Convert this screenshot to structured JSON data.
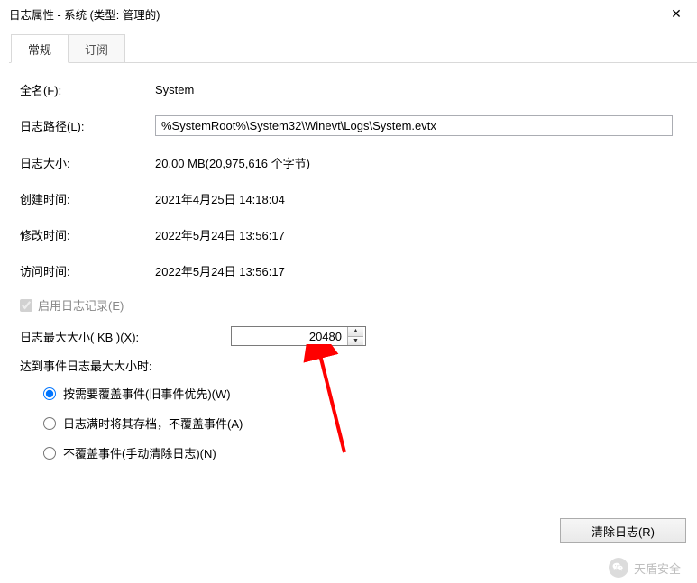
{
  "window": {
    "title": "日志属性 - 系统 (类型: 管理的)",
    "close_glyph": "✕"
  },
  "tabs": {
    "general": "常规",
    "subscribe": "订阅"
  },
  "fields": {
    "fullname_label": "全名(F):",
    "fullname_value": "System",
    "path_label": "日志路径(L):",
    "path_value": "%SystemRoot%\\System32\\Winevt\\Logs\\System.evtx",
    "size_label": "日志大小:",
    "size_value": "20.00 MB(20,975,616 个字节)",
    "created_label": "创建时间:",
    "created_value": "2021年4月25日 14:18:04",
    "modified_label": "修改时间:",
    "modified_value": "2022年5月24日 13:56:17",
    "accessed_label": "访问时间:",
    "accessed_value": "2022年5月24日 13:56:17"
  },
  "enable_logging": {
    "label": "启用日志记录(E)",
    "checked": true
  },
  "max_size": {
    "label": "日志最大大小( KB )(X):",
    "value": "20480"
  },
  "reach_label": "达到事件日志最大大小时:",
  "radios": {
    "r1": "按需要覆盖事件(旧事件优先)(W)",
    "r2": "日志满时将其存档，不覆盖事件(A)",
    "r3": "不覆盖事件(手动清除日志)(N)"
  },
  "footer": {
    "clear_button": "清除日志(R)"
  },
  "watermark": {
    "text": "天盾安全"
  }
}
